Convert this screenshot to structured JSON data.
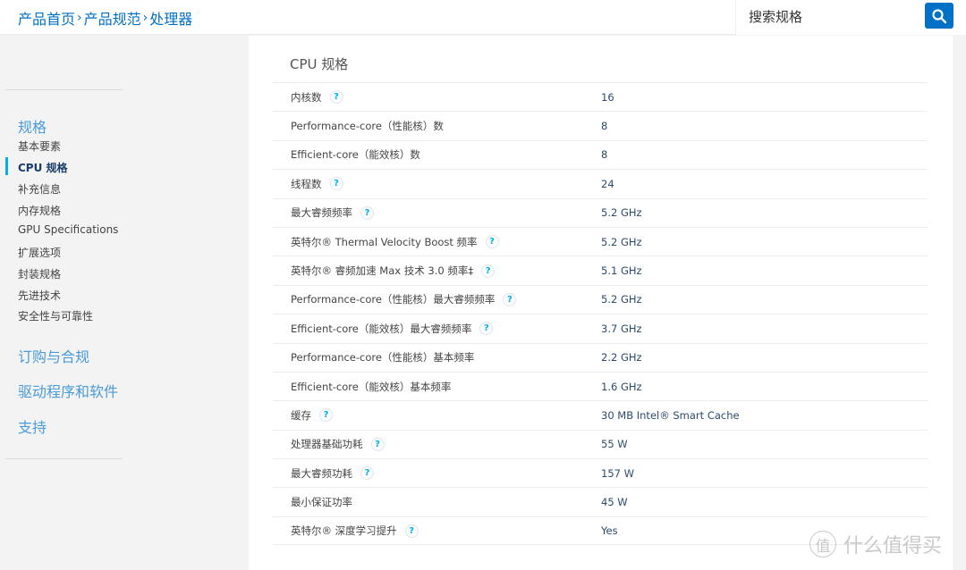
{
  "header": {
    "breadcrumb": [
      "产品首页",
      "产品规范",
      "处理器"
    ],
    "breadcrumb_separator": "›",
    "search_placeholder": "搜索规格",
    "search_icon": "search-icon",
    "accent_color": "#0071c5"
  },
  "sidebar": {
    "sections": [
      {
        "title": "规格",
        "items": [
          {
            "label": "基本要素",
            "active": false
          },
          {
            "label": "CPU 规格",
            "active": true
          },
          {
            "label": "补充信息",
            "active": false
          },
          {
            "label": "内存规格",
            "active": false
          },
          {
            "label": "GPU Specifications",
            "active": false
          },
          {
            "label": "扩展选项",
            "active": false
          },
          {
            "label": "封装规格",
            "active": false
          },
          {
            "label": "先进技术",
            "active": false
          },
          {
            "label": "安全性与可靠性",
            "active": false
          }
        ]
      },
      {
        "title": "订购与合规"
      },
      {
        "title": "驱动程序和软件"
      },
      {
        "title": "支持"
      }
    ]
  },
  "panel": {
    "title": "CPU 规格",
    "help_glyph": "?",
    "specs": [
      {
        "label": "内核数",
        "help": true,
        "value": "16"
      },
      {
        "label": "Performance-core（性能核）数",
        "help": false,
        "value": "8"
      },
      {
        "label": "Efficient-core（能效核）数",
        "help": false,
        "value": "8"
      },
      {
        "label": "线程数",
        "help": true,
        "value": "24"
      },
      {
        "label": "最大睿频频率",
        "help": true,
        "value": "5.2 GHz"
      },
      {
        "label": "英特尔® Thermal Velocity Boost 频率",
        "help": true,
        "value": "5.2 GHz"
      },
      {
        "label": "英特尔® 睿频加速 Max 技术 3.0 频率‡",
        "help": true,
        "value": "5.1 GHz"
      },
      {
        "label": "Performance-core（性能核）最大睿频频率",
        "help": true,
        "value": "5.2 GHz"
      },
      {
        "label": "Efficient-core（能效核）最大睿频频率",
        "help": true,
        "value": "3.7 GHz"
      },
      {
        "label": "Performance-core（性能核）基本频率",
        "help": false,
        "value": "2.2 GHz"
      },
      {
        "label": "Efficient-core（能效核）基本频率",
        "help": false,
        "value": "1.6 GHz"
      },
      {
        "label": "缓存",
        "help": true,
        "value": "30 MB Intel® Smart Cache"
      },
      {
        "label": "处理器基础功耗",
        "help": true,
        "value": "55 W"
      },
      {
        "label": "最大睿频功耗",
        "help": true,
        "value": "157 W"
      },
      {
        "label": "最小保证功率",
        "help": false,
        "value": "45 W"
      },
      {
        "label": "英特尔® 深度学习提升",
        "help": true,
        "value": "Yes"
      }
    ]
  },
  "watermark": {
    "glyph": "值",
    "text": "什么值得买"
  }
}
